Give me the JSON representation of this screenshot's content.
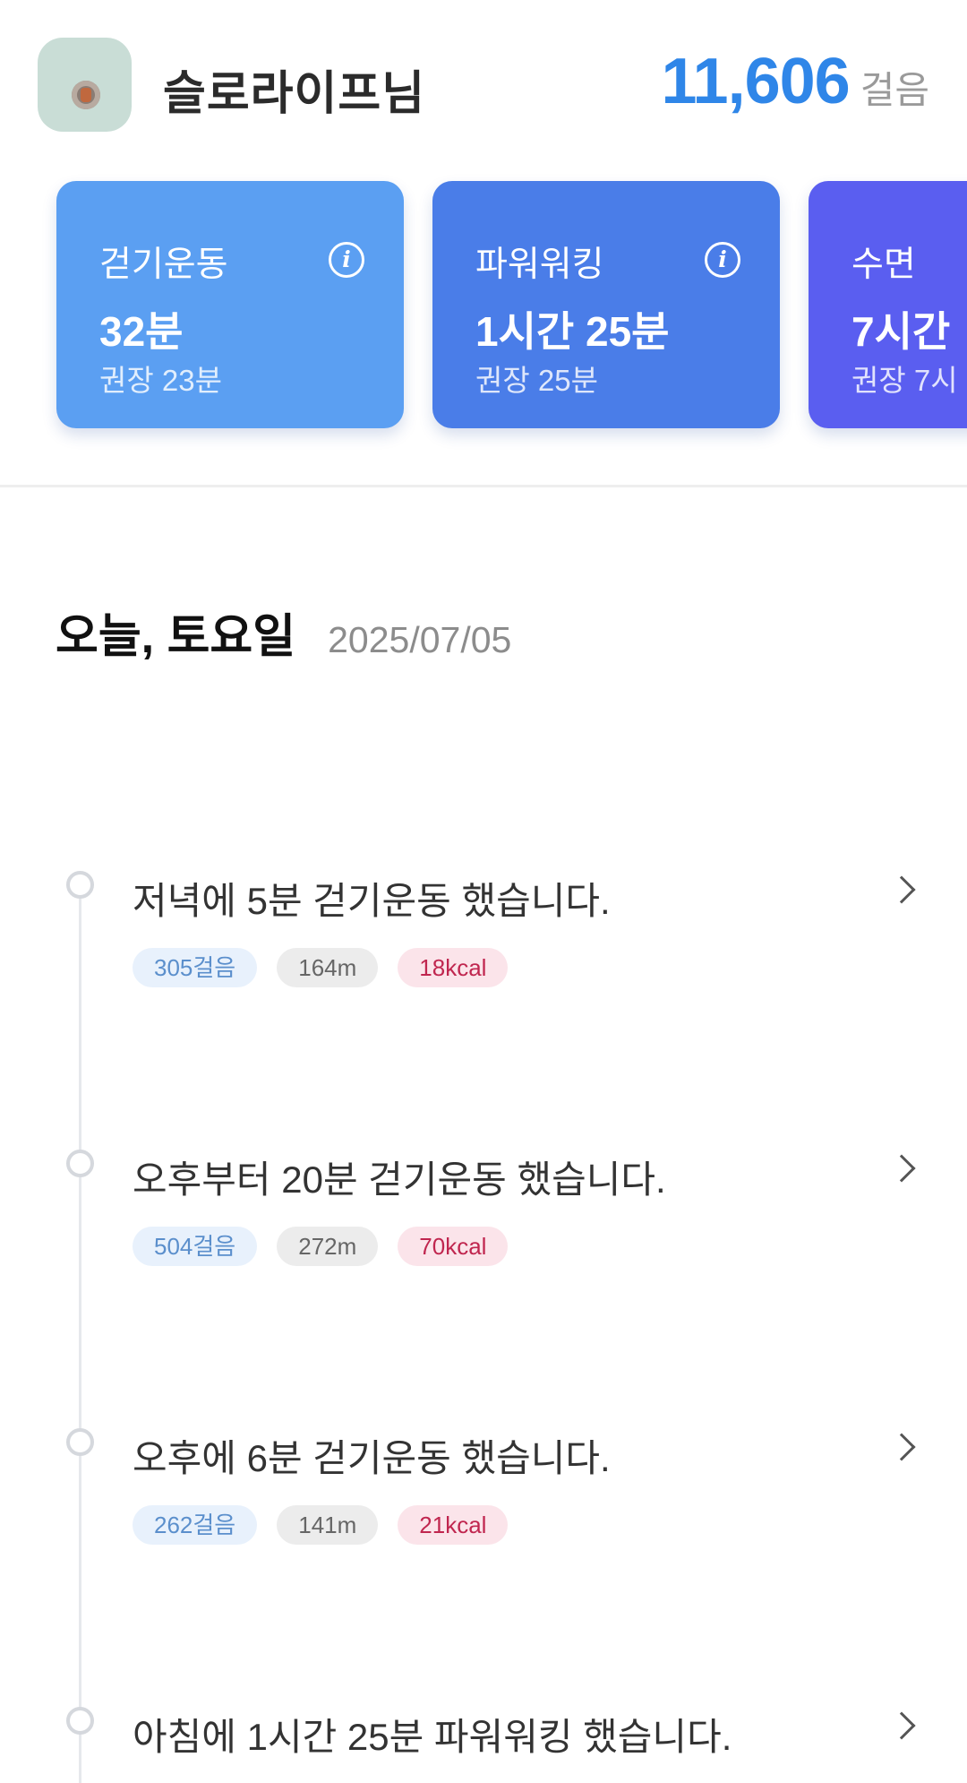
{
  "header": {
    "username": "슬로라이프님",
    "steps_value": "11,606",
    "steps_unit": "걸음"
  },
  "cards": [
    {
      "title": "걷기운동",
      "value": "32분",
      "sub": "권장 23분",
      "color": "#5b9ff2",
      "info_icon": "info-icon"
    },
    {
      "title": "파워워킹",
      "value": "1시간 25분",
      "sub": "권장 25분",
      "color": "#4a7de8",
      "info_icon": "info-icon"
    },
    {
      "title": "수면",
      "value": "7시간",
      "sub": "권장 7시",
      "color": "#5a5ef0"
    }
  ],
  "day": {
    "label": "오늘, 토요일",
    "date": "2025/07/05"
  },
  "activities": [
    {
      "text": "저녁에 5분 걷기운동 했습니다.",
      "steps": "305걸음",
      "distance": "164m",
      "kcal": "18kcal"
    },
    {
      "text": "오후부터 20분 걷기운동 했습니다.",
      "steps": "504걸음",
      "distance": "272m",
      "kcal": "70kcal"
    },
    {
      "text": "오후에 6분 걷기운동 했습니다.",
      "steps": "262걸음",
      "distance": "141m",
      "kcal": "21kcal"
    },
    {
      "text": "아침에 1시간 25분 파워워킹 했습니다."
    }
  ],
  "colors": {
    "accent": "#2f86e8",
    "steps_tag": "#5b8fcc",
    "kcal_tag": "#c0264f"
  }
}
